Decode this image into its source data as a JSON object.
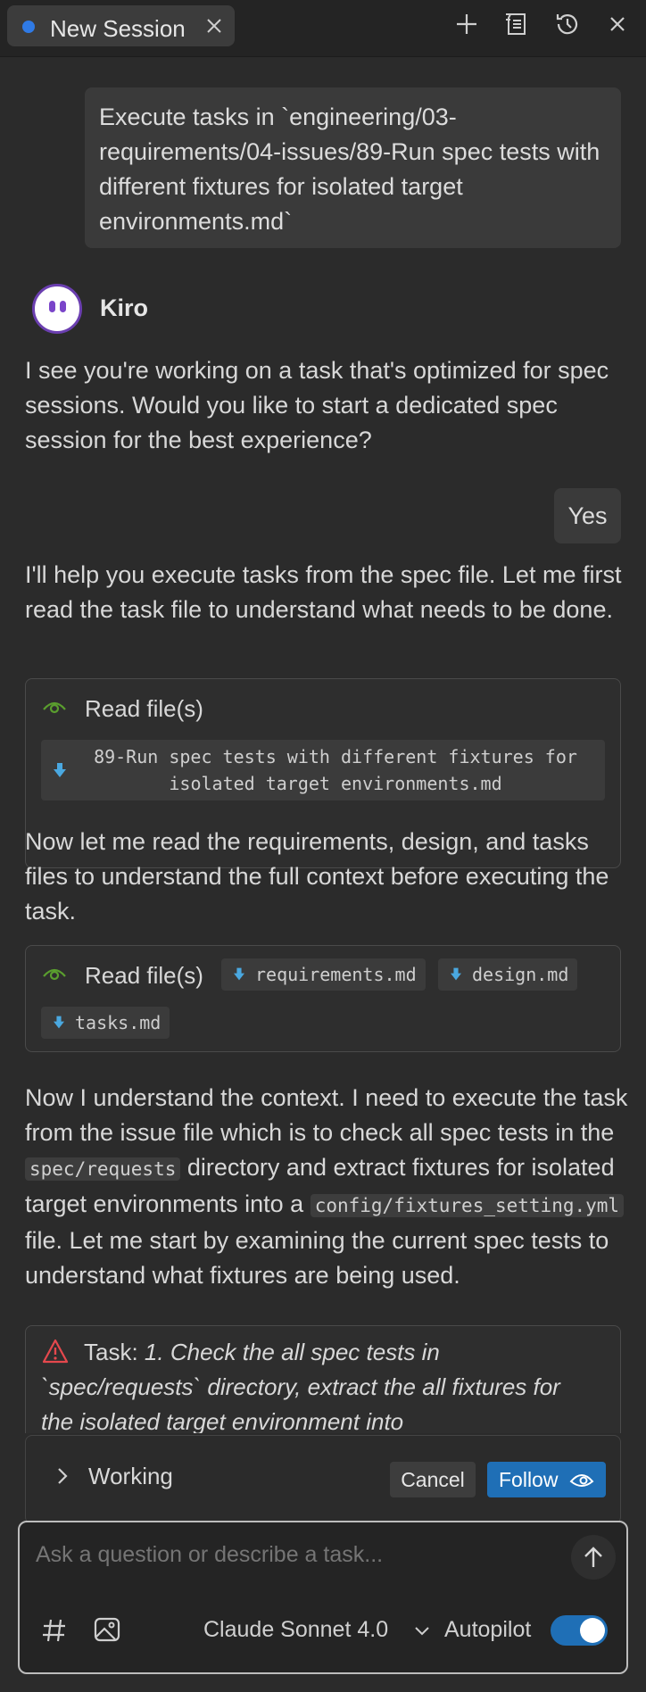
{
  "tab": {
    "title": "New Session",
    "dot_color": "#2f7ae5"
  },
  "toolbar": {
    "icons": [
      "plus-icon",
      "task-list-icon",
      "history-icon",
      "close-icon"
    ]
  },
  "conversation": {
    "user_message_1": "Execute tasks in `engineering/03-requirements/04-issues/89-Run spec tests with different fixtures for isolated target environments.md`",
    "agent_name": "Kiro",
    "agent_message_1": "I see you're working on a task that's optimized for spec sessions. Would you like to start a dedicated spec session for the best experience?",
    "user_reply": "Yes",
    "agent_message_2": "I'll help you execute tasks from the spec file. Let me first read the task file to understand what needs to be done.",
    "read_card_1": {
      "title": "Read file(s)",
      "file": "89-Run spec tests with different fixtures for isolated target environments.md"
    },
    "agent_message_3": "Now let me read the requirements, design, and tasks files to understand the full context before executing the task.",
    "read_card_2": {
      "title": "Read file(s)",
      "files": [
        "requirements.md",
        "design.md",
        "tasks.md"
      ]
    },
    "agent_message_4": {
      "part1": "Now I understand the context. I need to execute the task from the issue file which is to check all spec tests in the ",
      "code1": "spec/requests",
      "part2": " directory and extract fixtures for isolated target environments into a ",
      "code2": "config/fixtures_setting.yml",
      "part3": " file. Let me start by examining the current spec tests to understand what fixtures are being used."
    },
    "task_card": {
      "label": "Task: ",
      "text": "1. Check the all spec tests in `spec/requests` directory, extract the all fixtures for the isolated target environment into"
    }
  },
  "working_bar": {
    "label": "Working",
    "cancel_label": "Cancel",
    "follow_label": "Follow"
  },
  "composer": {
    "placeholder": "Ask a question or describe a task...",
    "model": "Claude Sonnet 4.0",
    "autopilot_label": "Autopilot",
    "autopilot_on": true
  },
  "colors": {
    "accent": "#1f6fb6",
    "eye_green": "#5a9e2e",
    "warning_red": "#e5484d",
    "file_icon_blue": "#4aa8e0",
    "avatar_purple": "#7a45c9"
  }
}
